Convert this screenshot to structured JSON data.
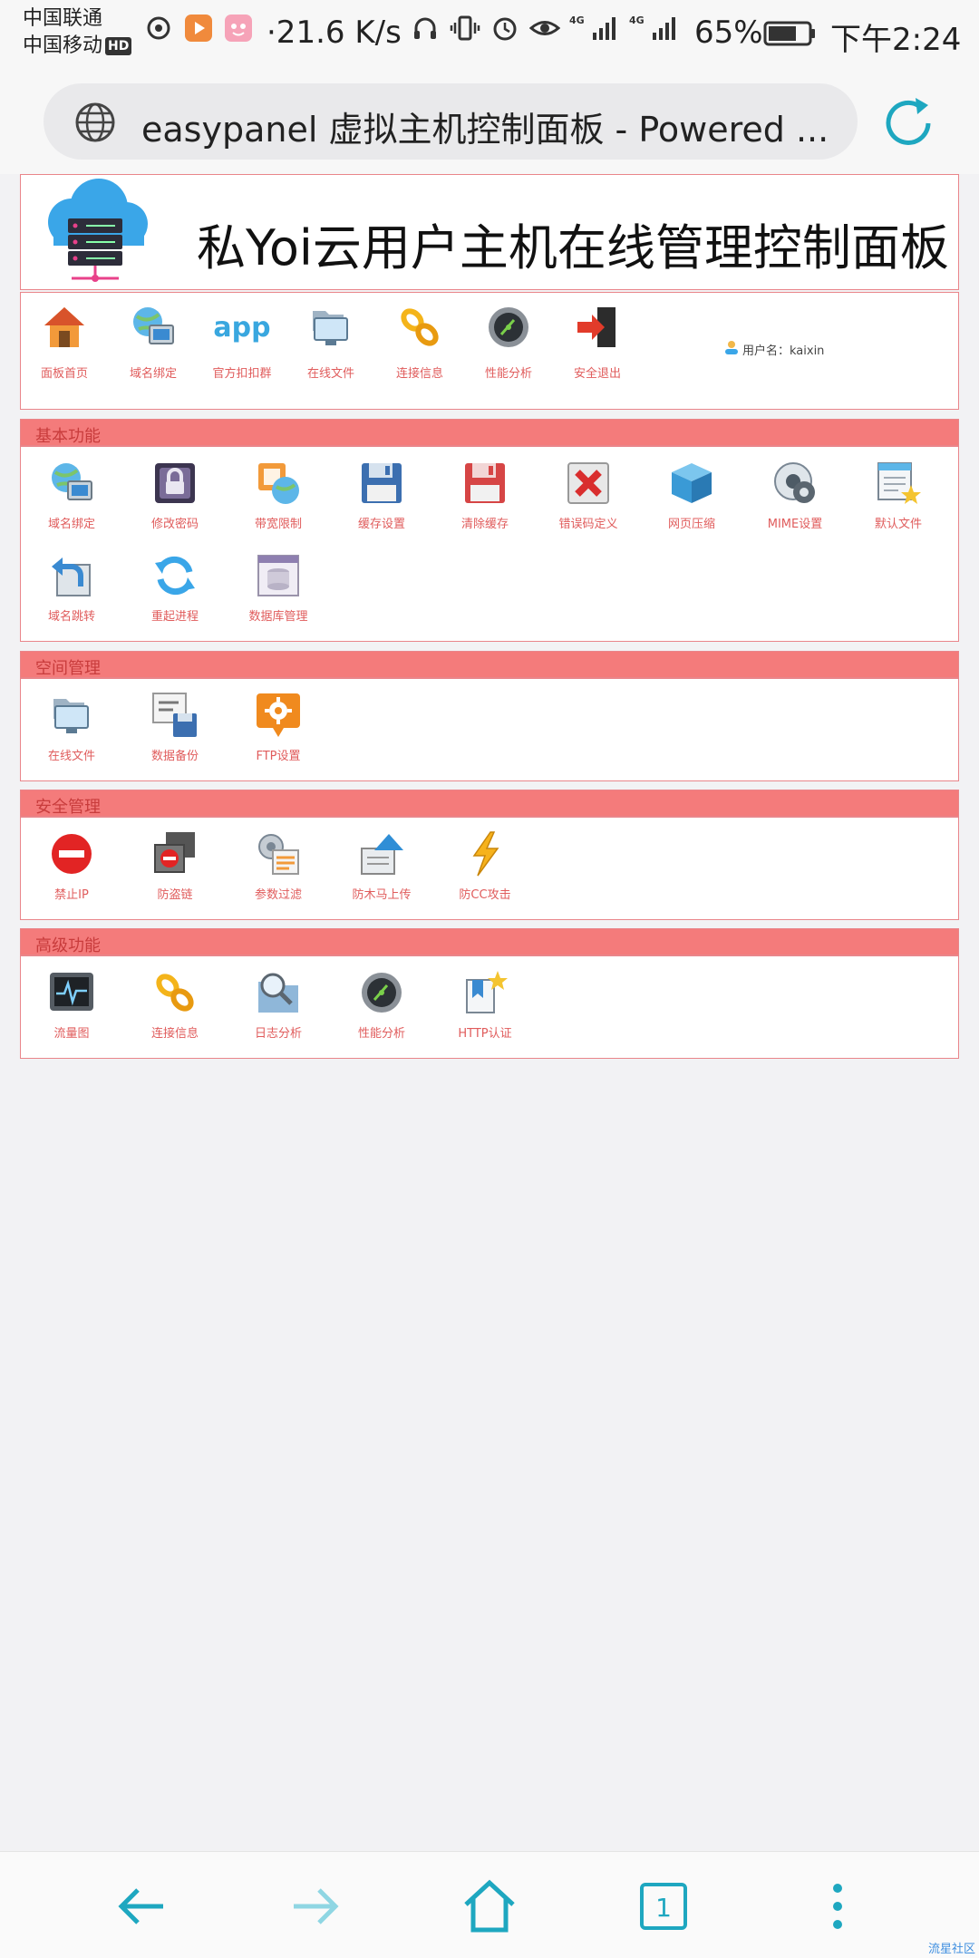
{
  "status_bar": {
    "carrier1": "中国联通",
    "carrier2": "中国移动",
    "hd": "HD",
    "speed": "·21.6 K/s",
    "battery": "65%",
    "time": "下午2:24",
    "net1": "4G",
    "net2": "4G"
  },
  "browser": {
    "page_title": "easypanel 虚拟主机控制面板 - Powered ...",
    "tab_count": "1",
    "accent_color": "#1ea7c0"
  },
  "header": {
    "title": "私Yoi云用户主机在线管理控制面板"
  },
  "nav": {
    "items": [
      {
        "label": "面板首页"
      },
      {
        "label": "域名绑定"
      },
      {
        "label": "官方扣扣群"
      },
      {
        "label": "在线文件"
      },
      {
        "label": "连接信息"
      },
      {
        "label": "性能分析"
      },
      {
        "label": "安全退出"
      }
    ],
    "app_logo_text": "app",
    "user_label": "用户名：kaixin"
  },
  "sections": [
    {
      "title": "基本功能",
      "items": [
        {
          "label": "域名绑定"
        },
        {
          "label": "修改密码"
        },
        {
          "label": "带宽限制"
        },
        {
          "label": "缓存设置"
        },
        {
          "label": "清除缓存"
        },
        {
          "label": "错误码定义"
        },
        {
          "label": "网页压缩"
        },
        {
          "label": "MIME设置"
        },
        {
          "label": "默认文件"
        },
        {
          "label": "域名跳转"
        },
        {
          "label": "重起进程"
        },
        {
          "label": "数据库管理"
        }
      ]
    },
    {
      "title": "空间管理",
      "items": [
        {
          "label": "在线文件"
        },
        {
          "label": "数据备份"
        },
        {
          "label": "FTP设置"
        }
      ]
    },
    {
      "title": "安全管理",
      "items": [
        {
          "label": "禁止IP"
        },
        {
          "label": "防盗链"
        },
        {
          "label": "参数过滤"
        },
        {
          "label": "防木马上传"
        },
        {
          "label": "防CC攻击"
        }
      ]
    },
    {
      "title": "高级功能",
      "items": [
        {
          "label": "流量图"
        },
        {
          "label": "连接信息"
        },
        {
          "label": "日志分析"
        },
        {
          "label": "性能分析"
        },
        {
          "label": "HTTP认证"
        }
      ]
    }
  ],
  "watermark": "流星社区",
  "colors": {
    "section_header": "#f47b7b",
    "label": "#e05c5c",
    "border": "#e9858a"
  }
}
